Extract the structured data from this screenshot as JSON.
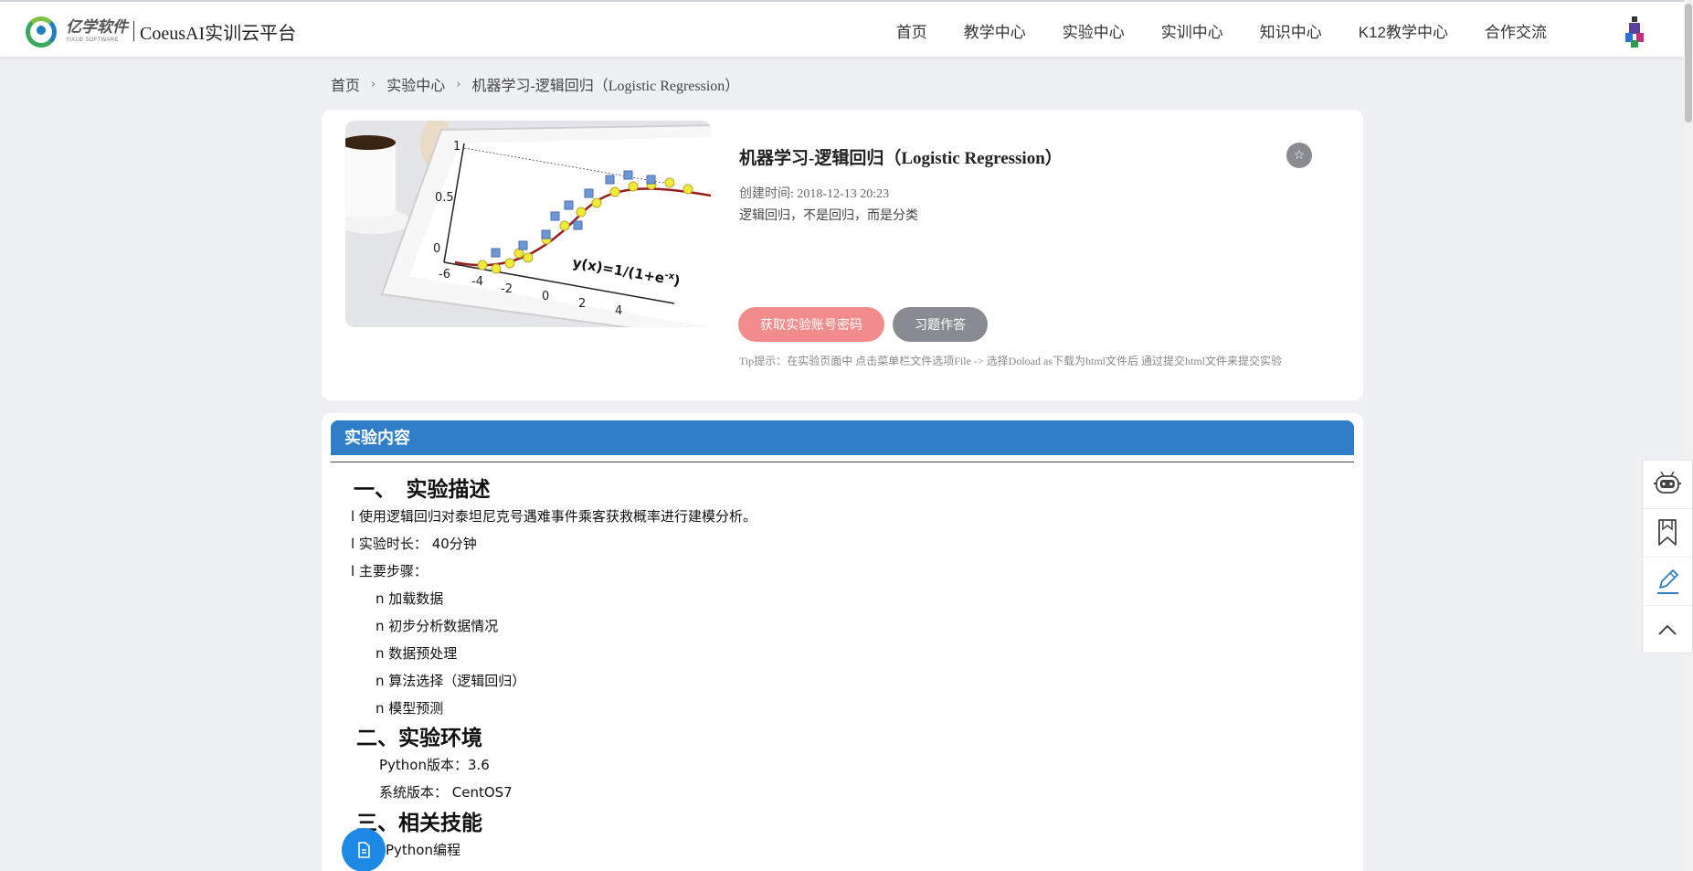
{
  "header": {
    "logo_cn": "亿学软件",
    "logo_en": "YIXUE SOFTWARE",
    "title": "CoeusAI实训云平台",
    "nav": [
      "首页",
      "教学中心",
      "实验中心",
      "实训中心",
      "知识中心",
      "K12教学中心",
      "合作交流"
    ]
  },
  "breadcrumb": [
    "首页",
    "实验中心",
    "机器学习-逻辑回归（Logistic Regression）"
  ],
  "experiment": {
    "title": "机器学习-逻辑回归（Logistic Regression）",
    "created_label": "创建时间:",
    "created_at": "2018-12-13 20:23",
    "description": "逻辑回归，不是回归，而是分类",
    "btn_account": "获取实验账号密码",
    "btn_quiz": "习题作答",
    "tip": "Tip提示：在实验页面中 点击菜单栏文件选项File -> 选择Doload as下载为html文件后 通过提交html文件来提交实验",
    "cover": {
      "formula": "y(x)=1/(1+e",
      "formula_exp": "-x",
      "formula_end": ")",
      "y_ticks": [
        "1",
        "0.5",
        "0"
      ],
      "x_ticks": [
        "-6",
        "-4",
        "-2",
        "0",
        "2",
        "4"
      ]
    }
  },
  "content": {
    "header": "实验内容",
    "s1_title": "一、　实验描述",
    "s1_lines": [
      "l  使用逻辑回归对泰坦尼克号遇难事件乘客获救概率进行建模分析。",
      "l  实验时长： 40分钟",
      "l  主要步骤："
    ],
    "steps": [
      "n  加载数据",
      "n  初步分析数据情况",
      "n  数据预处理",
      "n  算法选择（逻辑回归）",
      "n  模型预测"
    ],
    "s2_title": "二、实验环境",
    "env": [
      "Python版本：3.6",
      "系统版本： CentOS7"
    ],
    "s3_title": "三、相关技能",
    "skills": [
      "Python编程"
    ]
  },
  "colors": {
    "accent": "#2f7ec7",
    "account_btn": "#f28b8b",
    "quiz_btn": "#888c92"
  }
}
